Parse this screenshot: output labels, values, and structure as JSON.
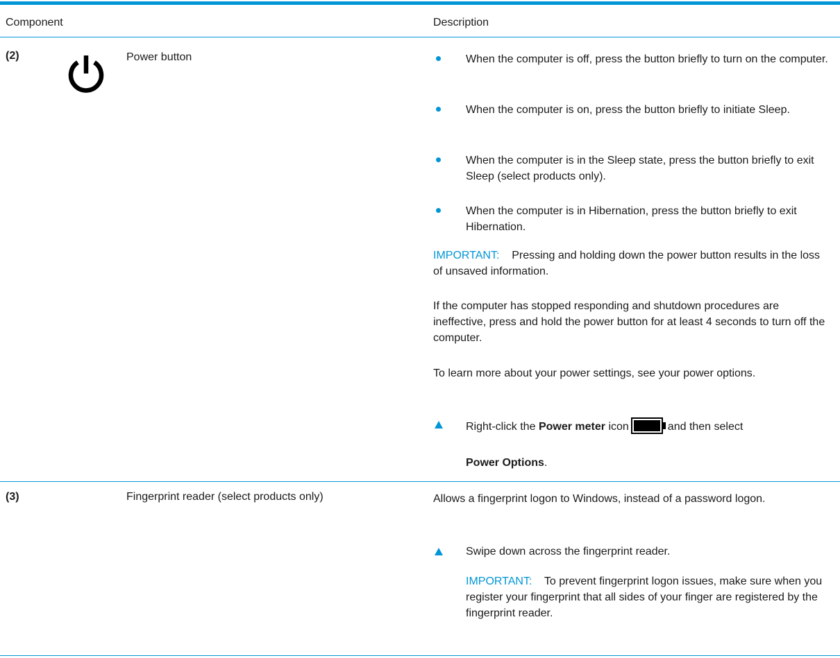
{
  "table": {
    "headers": {
      "component": "Component",
      "description": "Description"
    },
    "rows": [
      {
        "number": "(2)",
        "icon": "power-icon",
        "name": "Power button",
        "bullets": [
          "When the computer is off, press the button briefly to turn on the computer.",
          "When the computer is on, press the button briefly to initiate Sleep.",
          "When the computer is in the Sleep state, press the button briefly to exit Sleep (select products only).",
          "When the computer is in Hibernation, press the button briefly to exit Hibernation."
        ],
        "important_label": "IMPORTANT:",
        "important_text": "Pressing and holding down the power button results in the loss of unsaved information.",
        "para1": "If the computer has stopped responding and shutdown procedures are ineffective, press and hold the power button for at least 4 seconds to turn off the computer.",
        "para2": "To learn more about your power settings, see your power options.",
        "step_prefix": "Right-click the",
        "step_bold": "Power meter",
        "step_mid": "icon",
        "step_suffix": "and then select",
        "step_option": "Power Options",
        "step_end": "."
      },
      {
        "number": "(3)",
        "name": "Fingerprint reader (select products only)",
        "description": "Allows a fingerprint logon to Windows, instead of a password logon.",
        "step": "Swipe down across the fingerprint reader.",
        "important_label": "IMPORTANT:",
        "important_text": "To prevent fingerprint logon issues, make sure when you register your fingerprint that all sides of your finger are registered by the fingerprint reader."
      }
    ]
  },
  "colors": {
    "accent": "#0096d6",
    "text": "#1a1a1a"
  }
}
